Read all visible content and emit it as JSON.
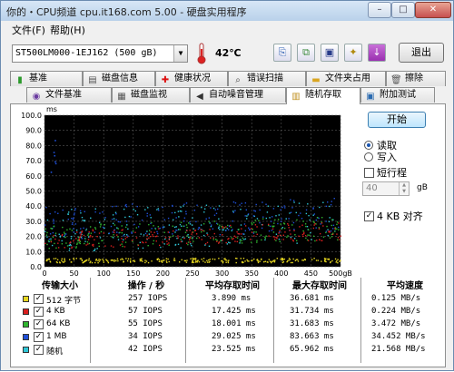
{
  "window": {
    "title": "你的・CPU频道 cpu.it168.com 5.00 - 硬盘实用程序"
  },
  "menu": {
    "file": "文件(F)",
    "help": "帮助(H)"
  },
  "toolbar": {
    "drive": "ST500LM000-1EJ162 (500 gB)",
    "temperature": "42℃",
    "exit_label": "退出"
  },
  "tabs_row1": [
    {
      "label": "基准",
      "icon": "benchmark-icon"
    },
    {
      "label": "磁盘信息",
      "icon": "disk-info-icon"
    },
    {
      "label": "健康状况",
      "icon": "health-icon"
    },
    {
      "label": "错误扫描",
      "icon": "error-scan-icon"
    },
    {
      "label": "文件夹占用",
      "icon": "folder-usage-icon"
    },
    {
      "label": "擦除",
      "icon": "erase-icon"
    }
  ],
  "tabs_row2": [
    {
      "label": "文件基准",
      "icon": "file-benchmark-icon"
    },
    {
      "label": "磁盘监视",
      "icon": "disk-monitor-icon"
    },
    {
      "label": "自动噪音管理",
      "icon": "noise-icon"
    },
    {
      "label": "随机存取",
      "icon": "random-access-icon"
    },
    {
      "label": "附加测试",
      "icon": "extra-tests-icon"
    }
  ],
  "controls": {
    "start": "开始",
    "read": "读取",
    "write": "写入",
    "short_stroke": "短行程",
    "short_stroke_value": "40",
    "short_stroke_unit": "gB",
    "align_4kb": "4 KB 对齐"
  },
  "chart_data": {
    "type": "scatter",
    "ylabel": "ms",
    "xunit": "gB",
    "xlim": [
      0,
      500
    ],
    "ylim": [
      0,
      100
    ],
    "x_ticks": [
      "0",
      "50",
      "100",
      "150",
      "200",
      "250",
      "300",
      "350",
      "400",
      "450",
      "500gB"
    ],
    "y_ticks": [
      "0.0",
      "10.0",
      "20.0",
      "30.0",
      "40.0",
      "50.0",
      "60.0",
      "70.0",
      "80.0",
      "90.0",
      "100.0"
    ],
    "grid": true,
    "series": [
      {
        "name": "512 字节",
        "color": "#e6d620",
        "y_band": [
          3,
          6
        ],
        "mean": 3.89
      },
      {
        "name": "4 KB",
        "color": "#d81e1e",
        "y_band": [
          12,
          24
        ],
        "mean": 17.425
      },
      {
        "name": "64 KB",
        "color": "#2fb52f",
        "y_band": [
          12,
          28
        ],
        "mean": 18.001
      },
      {
        "name": "1 MB",
        "color": "#1f4fd6",
        "y_band": [
          18,
          40
        ],
        "mean": 29.025
      },
      {
        "name": "随机",
        "color": "#2fc6d6",
        "y_band": [
          10,
          38
        ],
        "mean": 23.525
      }
    ]
  },
  "table": {
    "headers": [
      "传输大小",
      "操作 / 秒",
      "平均存取时间",
      "最大存取时间",
      "平均速度"
    ],
    "rows": [
      {
        "label": "512 字节",
        "color": "#e6d620",
        "ops": "257 IOPS",
        "avg": "3.890 ms",
        "max": "36.681 ms",
        "speed": "0.125 MB/s"
      },
      {
        "label": "4 KB",
        "color": "#d81e1e",
        "ops": "57 IOPS",
        "avg": "17.425 ms",
        "max": "31.734 ms",
        "speed": "0.224 MB/s"
      },
      {
        "label": "64 KB",
        "color": "#2fb52f",
        "ops": "55 IOPS",
        "avg": "18.001 ms",
        "max": "31.683 ms",
        "speed": "3.472 MB/s"
      },
      {
        "label": "1 MB",
        "color": "#1f4fd6",
        "ops": "34 IOPS",
        "avg": "29.025 ms",
        "max": "83.663 ms",
        "speed": "34.452 MB/s"
      },
      {
        "label": "随机",
        "color": "#2fc6d6",
        "ops": "42 IOPS",
        "avg": "23.525 ms",
        "max": "65.962 ms",
        "speed": "21.568 MB/s"
      }
    ]
  }
}
